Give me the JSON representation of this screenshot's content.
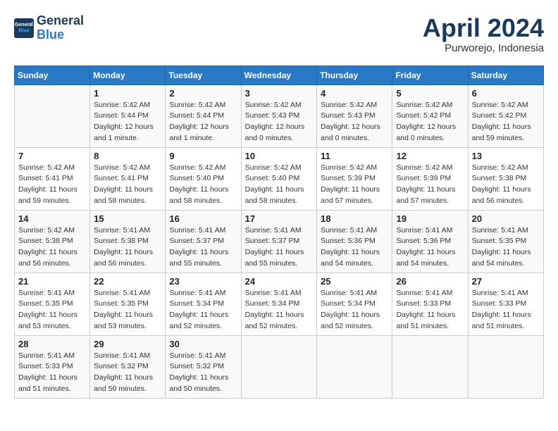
{
  "header": {
    "logo_line1": "General",
    "logo_line2": "Blue",
    "title": "April 2024",
    "subtitle": "Purworejo, Indonesia"
  },
  "weekdays": [
    "Sunday",
    "Monday",
    "Tuesday",
    "Wednesday",
    "Thursday",
    "Friday",
    "Saturday"
  ],
  "weeks": [
    [
      {
        "day": "",
        "info": ""
      },
      {
        "day": "1",
        "info": "Sunrise: 5:42 AM\nSunset: 5:44 PM\nDaylight: 12 hours\nand 1 minute."
      },
      {
        "day": "2",
        "info": "Sunrise: 5:42 AM\nSunset: 5:44 PM\nDaylight: 12 hours\nand 1 minute."
      },
      {
        "day": "3",
        "info": "Sunrise: 5:42 AM\nSunset: 5:43 PM\nDaylight: 12 hours\nand 0 minutes."
      },
      {
        "day": "4",
        "info": "Sunrise: 5:42 AM\nSunset: 5:43 PM\nDaylight: 12 hours\nand 0 minutes."
      },
      {
        "day": "5",
        "info": "Sunrise: 5:42 AM\nSunset: 5:42 PM\nDaylight: 12 hours\nand 0 minutes."
      },
      {
        "day": "6",
        "info": "Sunrise: 5:42 AM\nSunset: 5:42 PM\nDaylight: 11 hours\nand 59 minutes."
      }
    ],
    [
      {
        "day": "7",
        "info": "Sunrise: 5:42 AM\nSunset: 5:41 PM\nDaylight: 11 hours\nand 59 minutes."
      },
      {
        "day": "8",
        "info": "Sunrise: 5:42 AM\nSunset: 5:41 PM\nDaylight: 11 hours\nand 58 minutes."
      },
      {
        "day": "9",
        "info": "Sunrise: 5:42 AM\nSunset: 5:40 PM\nDaylight: 11 hours\nand 58 minutes."
      },
      {
        "day": "10",
        "info": "Sunrise: 5:42 AM\nSunset: 5:40 PM\nDaylight: 11 hours\nand 58 minutes."
      },
      {
        "day": "11",
        "info": "Sunrise: 5:42 AM\nSunset: 5:39 PM\nDaylight: 11 hours\nand 57 minutes."
      },
      {
        "day": "12",
        "info": "Sunrise: 5:42 AM\nSunset: 5:39 PM\nDaylight: 11 hours\nand 57 minutes."
      },
      {
        "day": "13",
        "info": "Sunrise: 5:42 AM\nSunset: 5:38 PM\nDaylight: 11 hours\nand 56 minutes."
      }
    ],
    [
      {
        "day": "14",
        "info": "Sunrise: 5:42 AM\nSunset: 5:38 PM\nDaylight: 11 hours\nand 56 minutes."
      },
      {
        "day": "15",
        "info": "Sunrise: 5:41 AM\nSunset: 5:38 PM\nDaylight: 11 hours\nand 56 minutes."
      },
      {
        "day": "16",
        "info": "Sunrise: 5:41 AM\nSunset: 5:37 PM\nDaylight: 11 hours\nand 55 minutes."
      },
      {
        "day": "17",
        "info": "Sunrise: 5:41 AM\nSunset: 5:37 PM\nDaylight: 11 hours\nand 55 minutes."
      },
      {
        "day": "18",
        "info": "Sunrise: 5:41 AM\nSunset: 5:36 PM\nDaylight: 11 hours\nand 54 minutes."
      },
      {
        "day": "19",
        "info": "Sunrise: 5:41 AM\nSunset: 5:36 PM\nDaylight: 11 hours\nand 54 minutes."
      },
      {
        "day": "20",
        "info": "Sunrise: 5:41 AM\nSunset: 5:35 PM\nDaylight: 11 hours\nand 54 minutes."
      }
    ],
    [
      {
        "day": "21",
        "info": "Sunrise: 5:41 AM\nSunset: 5:35 PM\nDaylight: 11 hours\nand 53 minutes."
      },
      {
        "day": "22",
        "info": "Sunrise: 5:41 AM\nSunset: 5:35 PM\nDaylight: 11 hours\nand 53 minutes."
      },
      {
        "day": "23",
        "info": "Sunrise: 5:41 AM\nSunset: 5:34 PM\nDaylight: 11 hours\nand 52 minutes."
      },
      {
        "day": "24",
        "info": "Sunrise: 5:41 AM\nSunset: 5:34 PM\nDaylight: 11 hours\nand 52 minutes."
      },
      {
        "day": "25",
        "info": "Sunrise: 5:41 AM\nSunset: 5:34 PM\nDaylight: 11 hours\nand 52 minutes."
      },
      {
        "day": "26",
        "info": "Sunrise: 5:41 AM\nSunset: 5:33 PM\nDaylight: 11 hours\nand 51 minutes."
      },
      {
        "day": "27",
        "info": "Sunrise: 5:41 AM\nSunset: 5:33 PM\nDaylight: 11 hours\nand 51 minutes."
      }
    ],
    [
      {
        "day": "28",
        "info": "Sunrise: 5:41 AM\nSunset: 5:33 PM\nDaylight: 11 hours\nand 51 minutes."
      },
      {
        "day": "29",
        "info": "Sunrise: 5:41 AM\nSunset: 5:32 PM\nDaylight: 11 hours\nand 50 minutes."
      },
      {
        "day": "30",
        "info": "Sunrise: 5:41 AM\nSunset: 5:32 PM\nDaylight: 11 hours\nand 50 minutes."
      },
      {
        "day": "",
        "info": ""
      },
      {
        "day": "",
        "info": ""
      },
      {
        "day": "",
        "info": ""
      },
      {
        "day": "",
        "info": ""
      }
    ]
  ]
}
